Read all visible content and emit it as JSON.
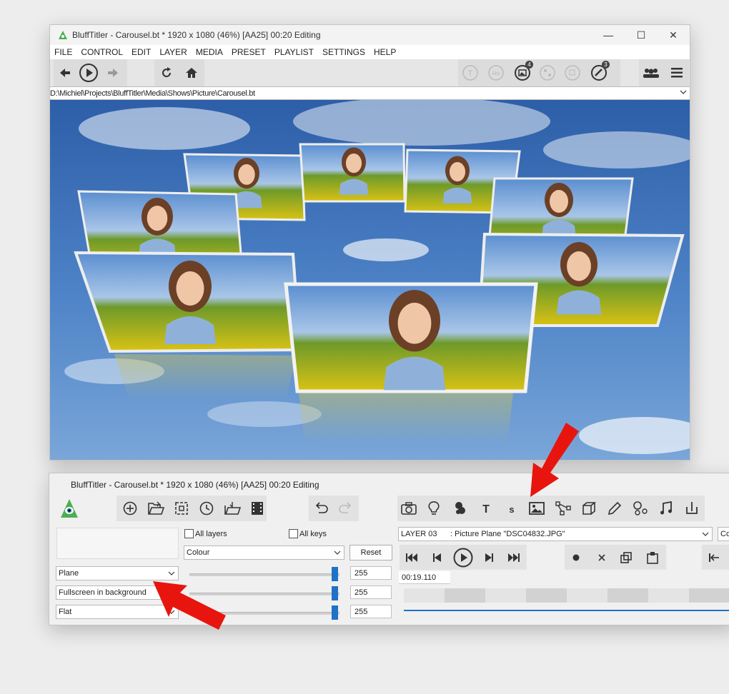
{
  "main_window": {
    "title": "BluffTitler - Carousel.bt * 1920 x 1080 (46%) [AA25] 00:20 Editing",
    "controls": {
      "minimize": "—",
      "maximize": "☐",
      "close": "✕"
    },
    "menu": [
      "FILE",
      "CONTROL",
      "EDIT",
      "LAYER",
      "MEDIA",
      "PRESET",
      "PLAYLIST",
      "SETTINGS",
      "HELP"
    ],
    "toolbar": {
      "picture_badge": "4",
      "clock_badge": "3"
    },
    "path": "D:\\Michiel\\Projects\\BluffTitler\\Media\\Shows\\Picture\\Carousel.bt"
  },
  "control_window": {
    "title": "BluffTitler - Carousel.bt * 1920 x 1080 (46%) [AA25] 00:20 Editing",
    "all_layers_label": "All layers",
    "all_keys_label": "All keys",
    "property_select": "Colour",
    "reset_label": "Reset",
    "style_selects": [
      "Plane",
      "Fullscreen in background",
      "Flat"
    ],
    "values": [
      "255",
      "255",
      "255"
    ],
    "slider_levels": [
      1.0,
      1.0,
      1.0
    ],
    "layer_select": "LAYER 03      : Picture Plane \"DSC04832.JPG\"",
    "right_select_partial": "Co",
    "time": "00:19.110"
  },
  "colors": {
    "accent_blue": "#1e72c8",
    "arrow_red": "#e8150f",
    "toolbar_bg": "#e6e6e6"
  }
}
